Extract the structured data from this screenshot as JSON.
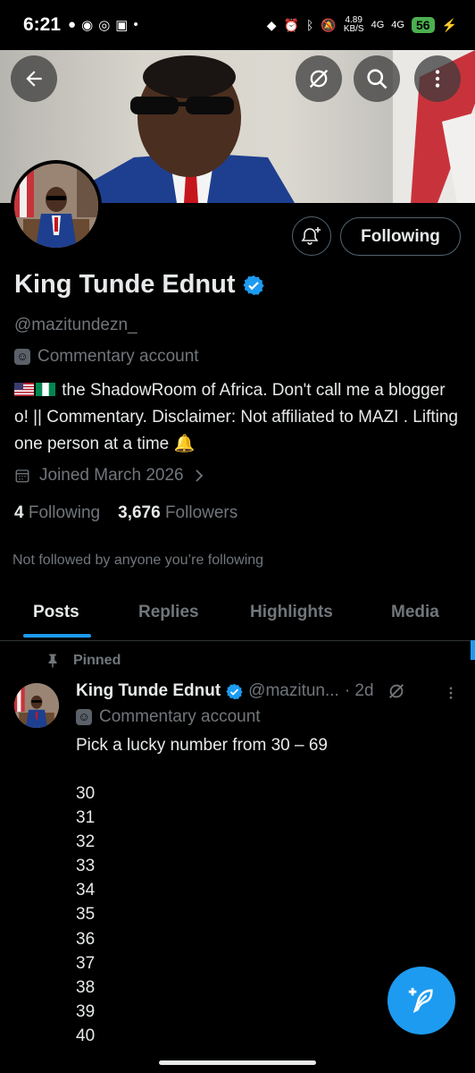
{
  "status_bar": {
    "time": "6:21",
    "net_speed_value": "4.89",
    "net_speed_unit": "KB/S",
    "net1": "4G",
    "net2": "4G",
    "battery": "56"
  },
  "profile": {
    "name": "King Tunde Ednut",
    "handle": "@mazitundezn_",
    "account_label": "Commentary account",
    "bio": "the ShadowRoom of Africa. Don't call me a blogger o! || Commentary. Disclaimer: Not affiliated to MAZI . Lifting one person at a time 🔔",
    "joined": "Joined March 2026",
    "following_count": "4",
    "following_label": "Following",
    "followers_count": "3,676",
    "followers_label": "Followers",
    "not_followed_text": "Not followed by anyone you’re following",
    "follow_button_label": "Following"
  },
  "tabs": [
    {
      "label": "Posts",
      "active": true
    },
    {
      "label": "Replies",
      "active": false
    },
    {
      "label": "Highlights",
      "active": false
    },
    {
      "label": "Media",
      "active": false
    }
  ],
  "post": {
    "pinned_label": "Pinned",
    "author_name": "King Tunde Ednut",
    "author_handle": "@mazitun...",
    "time": "· 2d",
    "account_label": "Commentary account",
    "text": "Pick a lucky number from 30 – 69",
    "numbers": [
      "30",
      "31",
      "32",
      "33",
      "34",
      "35",
      "36",
      "37",
      "38",
      "39",
      "40"
    ]
  },
  "colors": {
    "accent": "#1d9bf0",
    "background": "#000000",
    "secondary_text": "#71767b"
  },
  "icons": [
    "back-arrow-icon",
    "grok-icon",
    "search-icon",
    "more-vertical-icon",
    "bell-plus-icon",
    "verified-badge-icon",
    "mask-icon",
    "calendar-icon",
    "chevron-right-icon",
    "pin-icon",
    "compose-icon"
  ]
}
